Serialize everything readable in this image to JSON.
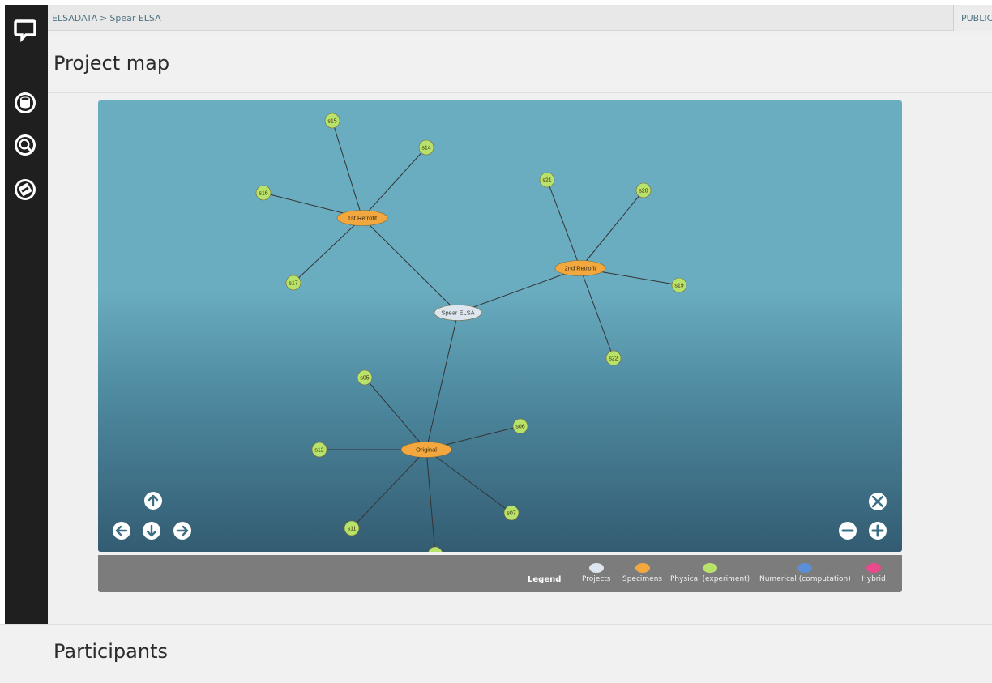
{
  "breadcrumb": {
    "root": "ELSADATA",
    "separator": ">",
    "current": "Spear ELSA"
  },
  "visibility": "PUBLIC",
  "sidebar": {
    "logo": "chat-bubble-logo-icon",
    "items": [
      {
        "icon": "database-icon"
      },
      {
        "icon": "search-icon"
      },
      {
        "icon": "manual-book-icon"
      }
    ]
  },
  "sections": {
    "project_map": "Project map",
    "participants": "Participants"
  },
  "graph": {
    "colors": {
      "project": "#dde6ee",
      "specimen": "#f2a83f",
      "physical": "#b8e36a",
      "numerical": "#5b8fd8",
      "hybrid": "#e84a8c",
      "edge": "#333333"
    },
    "nodes": [
      {
        "id": "spear",
        "label": "Spear ELSA",
        "kind": "project"
      },
      {
        "id": "r1",
        "label": "1st Retrofit",
        "kind": "specimen"
      },
      {
        "id": "r2",
        "label": "2nd Retrofit",
        "kind": "specimen"
      },
      {
        "id": "orig",
        "label": "Original",
        "kind": "specimen"
      },
      {
        "id": "s15",
        "label": "s15",
        "kind": "physical"
      },
      {
        "id": "s14",
        "label": "s14",
        "kind": "physical"
      },
      {
        "id": "s16",
        "label": "s16",
        "kind": "physical"
      },
      {
        "id": "s17",
        "label": "s17",
        "kind": "physical"
      },
      {
        "id": "s21",
        "label": "s21",
        "kind": "physical"
      },
      {
        "id": "s20",
        "label": "s20",
        "kind": "physical"
      },
      {
        "id": "s19",
        "label": "s19",
        "kind": "physical"
      },
      {
        "id": "s22",
        "label": "s22",
        "kind": "physical"
      },
      {
        "id": "s05",
        "label": "s05",
        "kind": "physical"
      },
      {
        "id": "s06",
        "label": "s06",
        "kind": "physical"
      },
      {
        "id": "s12",
        "label": "s12",
        "kind": "physical"
      },
      {
        "id": "s07",
        "label": "s07",
        "kind": "physical"
      },
      {
        "id": "s11",
        "label": "s11",
        "kind": "physical"
      },
      {
        "id": "sx",
        "label": "",
        "kind": "physical"
      }
    ],
    "edges": [
      [
        "spear",
        "r1"
      ],
      [
        "spear",
        "r2"
      ],
      [
        "spear",
        "orig"
      ],
      [
        "r1",
        "s15"
      ],
      [
        "r1",
        "s14"
      ],
      [
        "r1",
        "s16"
      ],
      [
        "r1",
        "s17"
      ],
      [
        "r2",
        "s21"
      ],
      [
        "r2",
        "s20"
      ],
      [
        "r2",
        "s19"
      ],
      [
        "r2",
        "s22"
      ],
      [
        "orig",
        "s05"
      ],
      [
        "orig",
        "s06"
      ],
      [
        "orig",
        "s12"
      ],
      [
        "orig",
        "s07"
      ],
      [
        "orig",
        "s11"
      ],
      [
        "orig",
        "sx"
      ]
    ]
  },
  "controls": {
    "pan": [
      "arrow-up-icon",
      "arrow-left-icon",
      "arrow-down-icon",
      "arrow-right-icon"
    ],
    "zoom": [
      "fit-to-screen-icon",
      "zoom-out-icon",
      "zoom-in-icon"
    ]
  },
  "legend": {
    "title": "Legend",
    "items": [
      {
        "label": "Projects",
        "color": "#dde6ee"
      },
      {
        "label": "Specimens",
        "color": "#f2a83f"
      },
      {
        "label": "Physical (experiment)",
        "color": "#b8e36a"
      },
      {
        "label": "Numerical (computation)",
        "color": "#5b8fd8"
      },
      {
        "label": "Hybrid",
        "color": "#e84a8c"
      }
    ]
  }
}
